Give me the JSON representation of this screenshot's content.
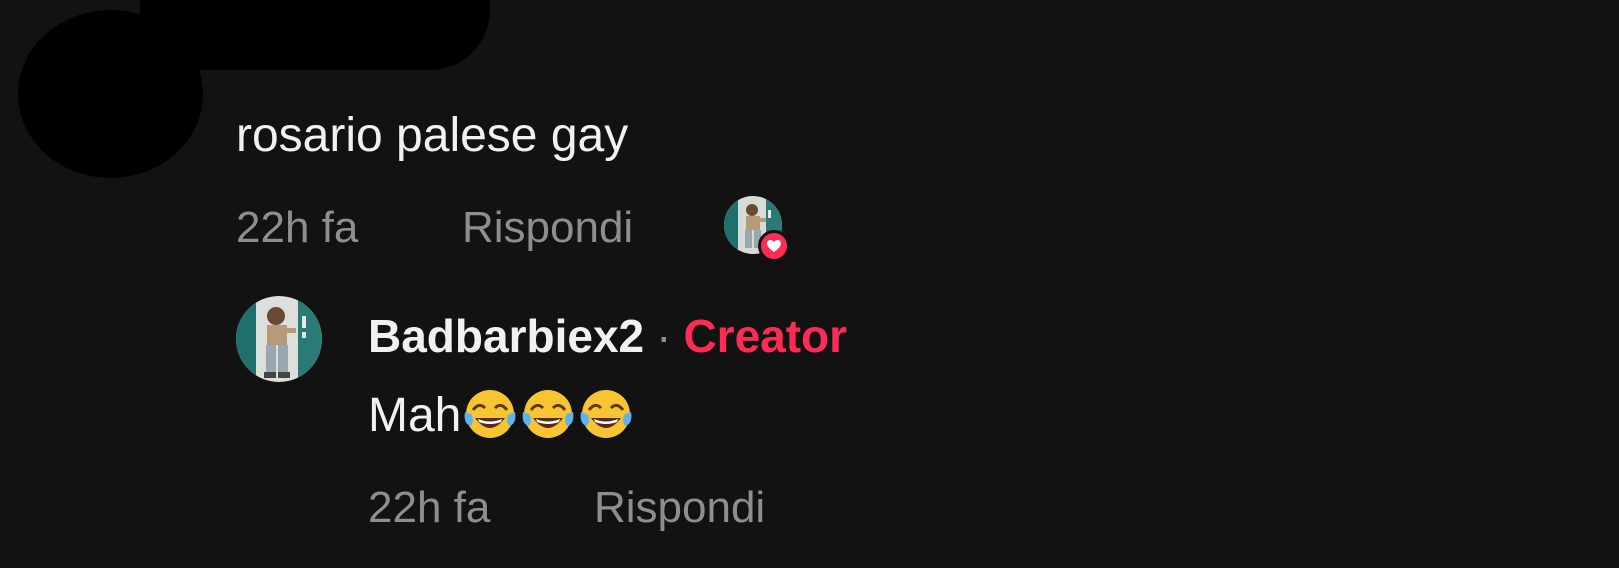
{
  "comment": {
    "text": "rosario palese gay",
    "time": "22h fa",
    "reply_label": "Rispondi",
    "liked_by_creator": true
  },
  "reply": {
    "username": "Badbarbiex2",
    "separator": "·",
    "badge": "Creator",
    "text": "Mah",
    "emojis": [
      "face-with-tears-of-joy",
      "face-with-tears-of-joy",
      "face-with-tears-of-joy"
    ],
    "time": "22h fa",
    "reply_label": "Rispondi"
  },
  "colors": {
    "background": "#121212",
    "text_primary": "#f1f1f1",
    "text_secondary": "#8e8e8e",
    "accent": "#fe2c55",
    "redaction": "#000000"
  }
}
